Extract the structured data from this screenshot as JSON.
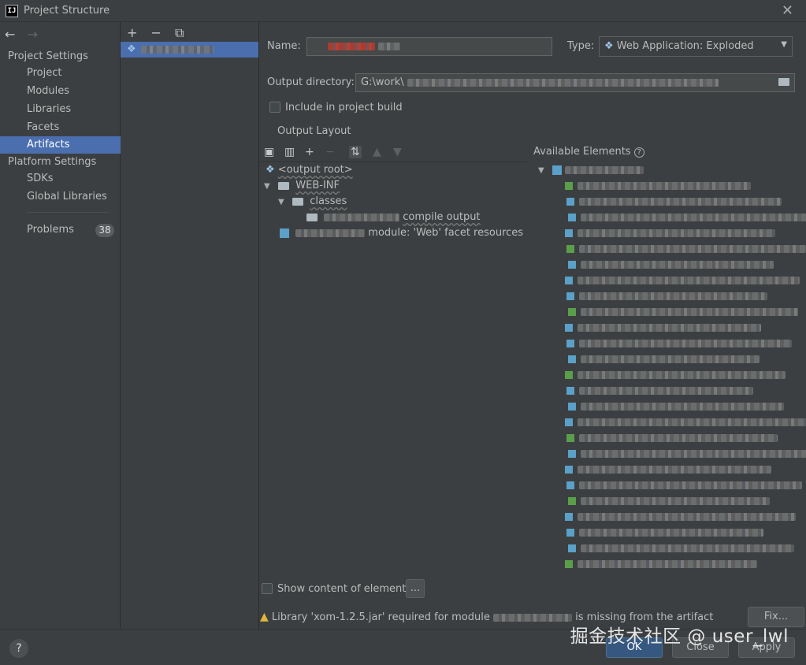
{
  "window": {
    "title": "Project Structure",
    "logo_text": "IJ",
    "close_glyph": "✕"
  },
  "nav": {
    "back_glyph": "←",
    "forward_glyph": "→"
  },
  "sidebar": {
    "project_settings_header": "Project Settings",
    "project_items": [
      "Project",
      "Modules",
      "Libraries",
      "Facets",
      "Artifacts"
    ],
    "platform_settings_header": "Platform Settings",
    "platform_items": [
      "SDKs",
      "Global Libraries"
    ],
    "problems_label": "Problems",
    "problems_count": "38"
  },
  "artifact_toolbar": {
    "add": "+",
    "remove": "−",
    "copy": "⧉"
  },
  "form": {
    "name_label": "Name:",
    "type_label": "Type:",
    "type_value": "Web Application: Exploded",
    "output_dir_label": "Output directory:",
    "output_dir_value": "G:\\work\\",
    "include_label": "Include in project build",
    "output_layout_label": "Output Layout",
    "available_elements_label": "Available Elements",
    "help_glyph": "?"
  },
  "layout_tree": {
    "output_root": "<output root>",
    "web_inf": "WEB-INF",
    "classes": "classes",
    "compile_output": "compile output",
    "facet_resources": "module: 'Web' facet resources"
  },
  "bottom": {
    "show_content_label": "Show content of elements",
    "ellipsis_button": "...",
    "warning_prefix": "Library 'xom-1.2.5.jar' required for module",
    "warning_suffix": "is missing from the artifact",
    "fix_button": "Fix..."
  },
  "footer": {
    "help_button": "?",
    "ok_button": "OK",
    "close_button": "Close",
    "apply_button": "Apply"
  },
  "watermark": "掘金技术社区 @ user_lwl",
  "colors": {
    "selection": "#4b6eaf",
    "background": "#3c3f41",
    "warning": "#e0b53b"
  }
}
